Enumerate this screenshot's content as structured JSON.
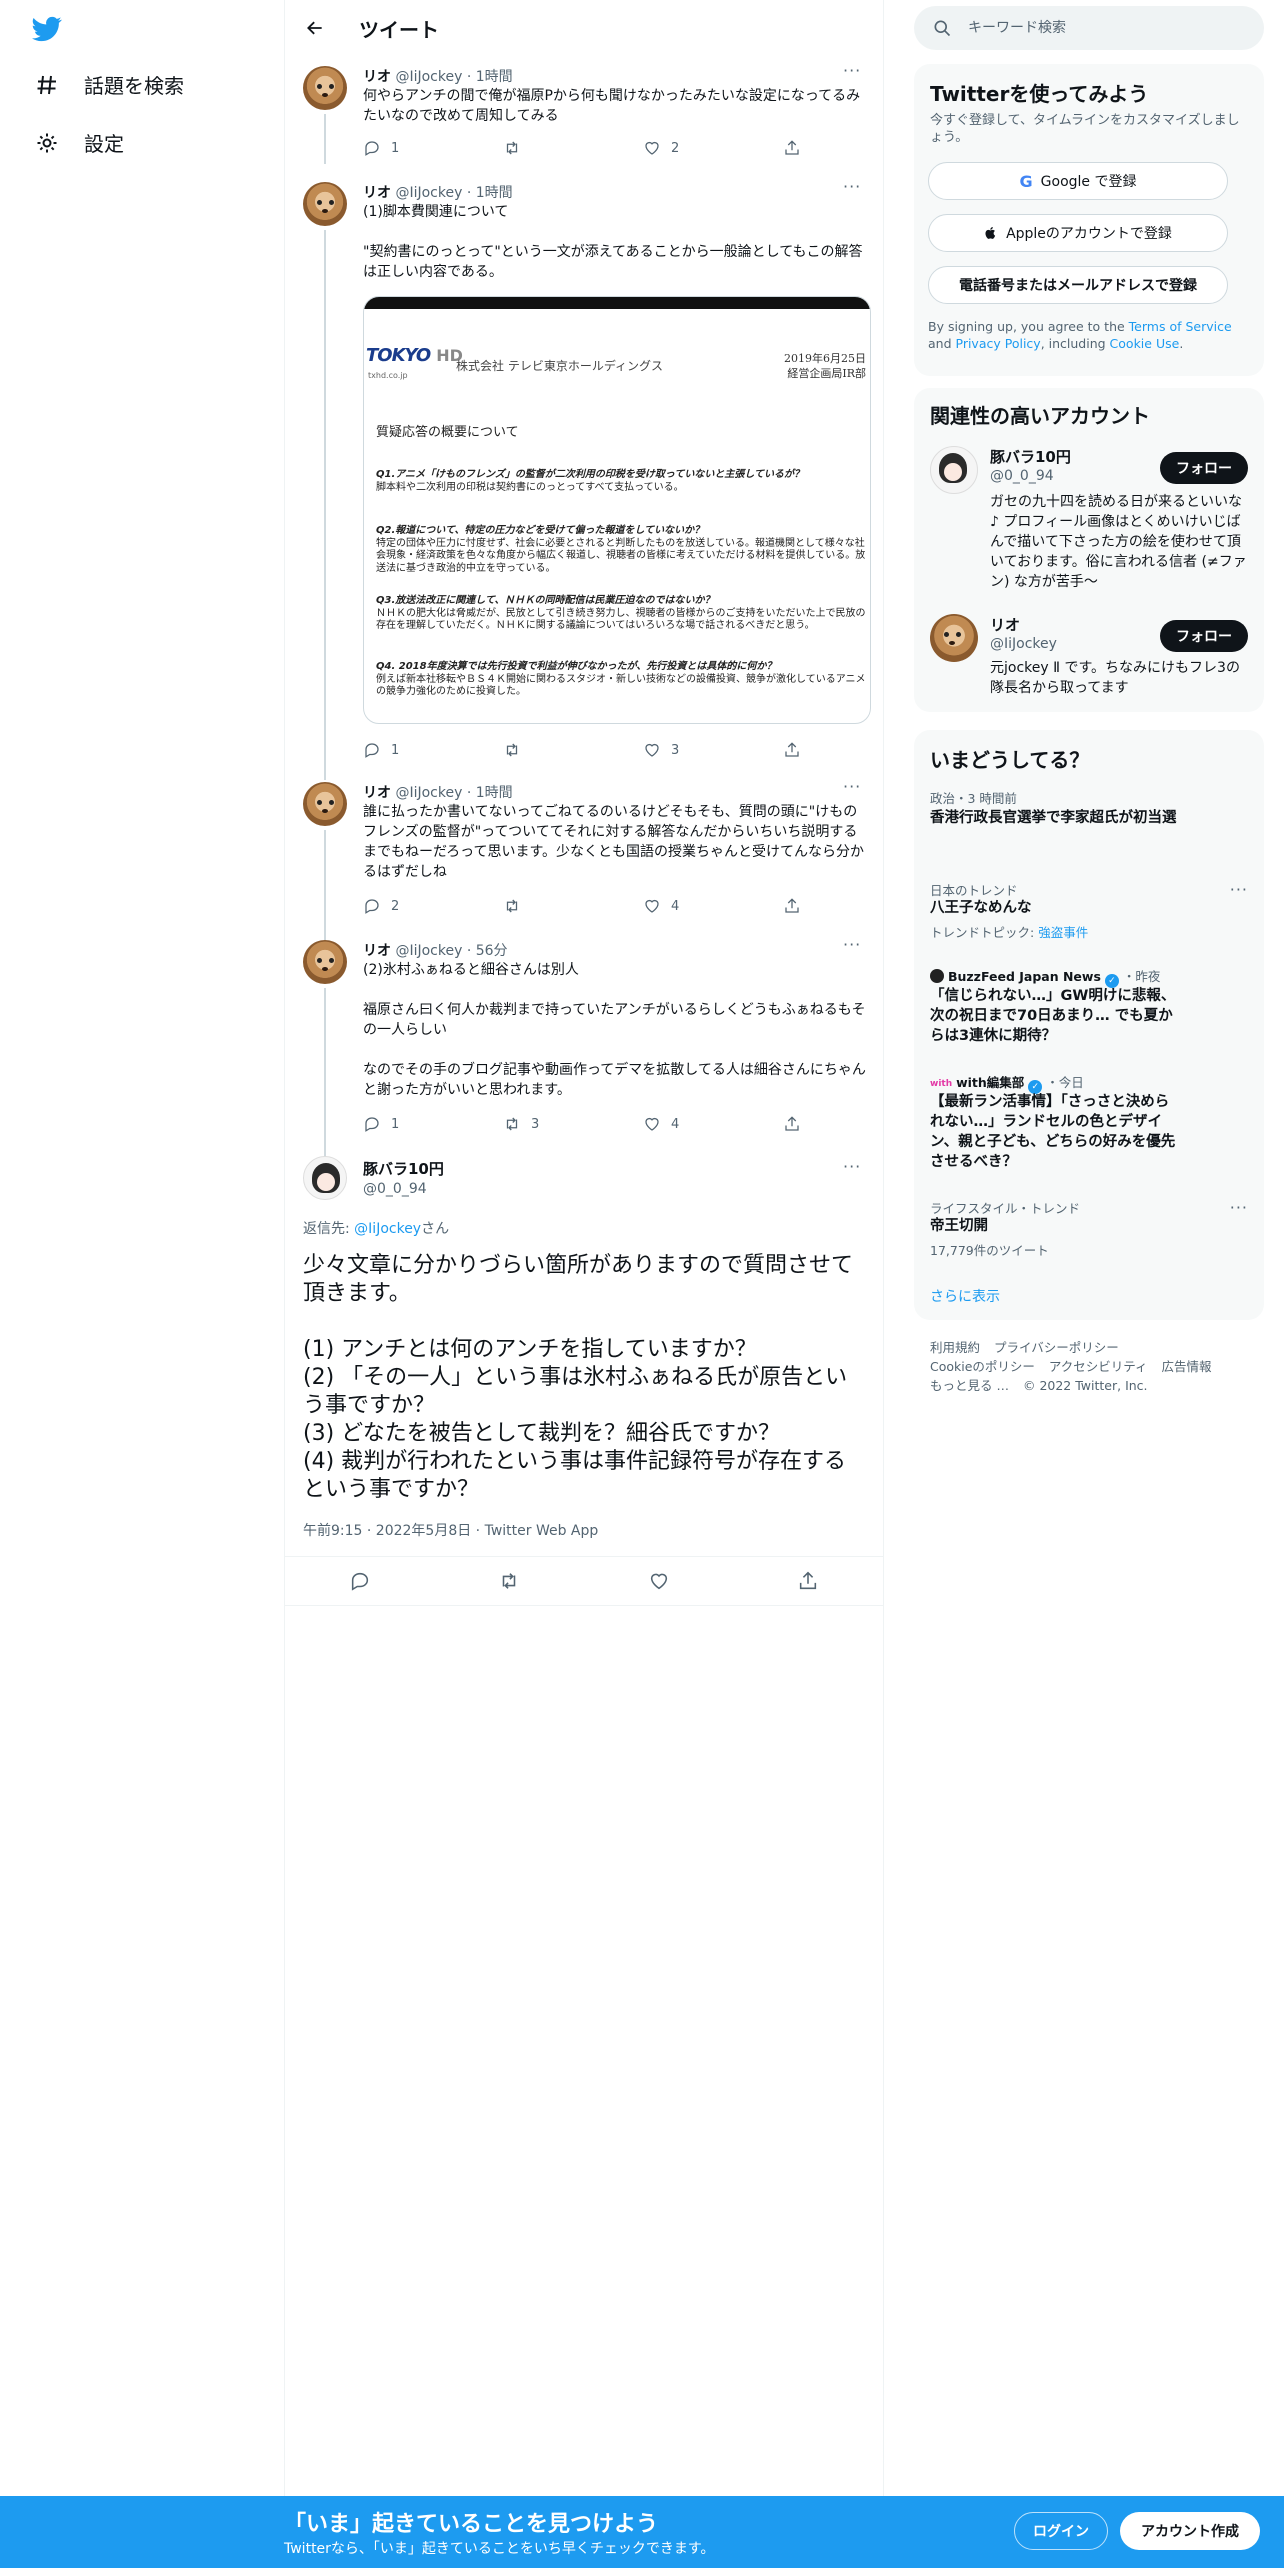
{
  "nav": {
    "explore_label": "話題を検索",
    "settings_label": "設定"
  },
  "header": {
    "title": "ツイート"
  },
  "tweets": [
    {
      "name": "リオ",
      "handle": "@IiJockey",
      "time": "1時間",
      "text": "何やらアンチの間で俺が福原Pから何も聞けなかったみたいな設定になってるみたいなので改めて周知してみる",
      "replies": "1",
      "retweets": "",
      "likes": "2"
    },
    {
      "name": "リオ",
      "handle": "@IiJockey",
      "time": "1時間",
      "text": "(1)脚本費関連について\n\n\"契約書にのっとって\"という一文が添えてあることから一般論としてもこの解答は正しい内容である。",
      "replies": "1",
      "retweets": "",
      "likes": "3",
      "image": {
        "logo_text": "TOKYO",
        "logo_hd": "HD",
        "url": "txhd.co.jp",
        "company": "株式会社 テレビ東京ホールディングス",
        "date": "2019年6月25日",
        "dept": "経営企画局IR部",
        "section": "質疑応答の概要について",
        "qa": [
          {
            "q": "Q1.アニメ「けものフレンズ」の監督が二次利用の印税を受け取っていないと主張しているが？",
            "a": "脚本料や二次利用の印税は契約書にのっとってすべて支払っている。"
          },
          {
            "q": "Q2.報道について、特定の圧力などを受けて偏った報道をしていないか？",
            "a": "特定の団体や圧力に忖度せず、社会に必要とされると判断したものを放送している。報道機関として様々な社会現象・経済政策を色々な角度から幅広く報道し、視聴者の皆様に考えていただける材料を提供している。放送法に基づき政治的中立を守っている。"
          },
          {
            "q": "Q3.放送法改正に関連して、ＮＨＫの同時配信は民業圧迫なのではないか？",
            "a": "ＮＨＫの肥大化は脅威だが、民放として引き続き努力し、視聴者の皆様からのご支持をいただいた上で民放の存在を理解していただく。ＮＨＫに関する議論についてはいろいろな場で話されるべきだと思う。"
          },
          {
            "q": "Q4. 2018年度決算では先行投資で利益が伸びなかったが、先行投資とは具体的に何か？",
            "a": "例えば新本社移転やＢＳ４Ｋ開始に関わるスタジオ・新しい技術などの設備投資、競争が激化しているアニメの競争力強化のために投資した。"
          }
        ]
      }
    },
    {
      "name": "リオ",
      "handle": "@IiJockey",
      "time": "1時間",
      "text": "誰に払ったか書いてないってごねてるのいるけどそもそも、質問の頭に\"けものフレンズの監督が\"ってついててそれに対する解答なんだからいちいち説明するまでもねーだろって思います。少なくとも国語の授業ちゃんと受けてんなら分かるはずだしね",
      "replies": "2",
      "retweets": "",
      "likes": "4"
    },
    {
      "name": "リオ",
      "handle": "@IiJockey",
      "time": "56分",
      "text": "(2)氷村ふぁねると細谷さんは別人\n\n福原さん曰く何人か裁判まで持っていたアンチがいるらしくどうもふぁねるもその一人らしい\n\nなのでその手のブログ記事や動画作ってデマを拡散してる人は細谷さんにちゃんと謝った方がいいと思われます。",
      "replies": "1",
      "retweets": "3",
      "likes": "4"
    }
  ],
  "main_tweet": {
    "name": "豚バラ10円",
    "handle": "@0_0_94",
    "reply_prefix": "返信先: ",
    "reply_to": "@IiJockey",
    "reply_suffix": "さん",
    "text": "少々文章に分かりづらい箇所がありますので質問させて頂きます。\n\n(1) アンチとは何のアンチを指していますか？\n(2) 「その一人」という事は氷村ふぁねる氏が原告という事ですか？\n(3) どなたを被告として裁判を？細谷氏ですか？\n(4) 裁判が行われたという事は事件記録符号が存在するという事ですか？",
    "meta": "午前9:15 · 2022年5月8日 · Twitter Web App"
  },
  "search": {
    "placeholder": "キーワード検索"
  },
  "signup_card": {
    "title": "Twitterを使ってみよう",
    "subtitle": "今すぐ登録して、タイムラインをカスタマイズしましょう。",
    "google": "Google で登録",
    "apple": "Appleのアカウントで登録",
    "phone": "電話番号またはメールアドレスで登録",
    "terms_1": "By signing up, you agree to the ",
    "terms_link": "Terms of Service",
    "terms_2": " and ",
    "privacy_link": "Privacy Policy",
    "terms_3": ", including ",
    "cookie_link": "Cookie Use",
    "terms_4": "."
  },
  "related": {
    "title": "関連性の高いアカウント",
    "accounts": [
      {
        "name": "豚バラ10円",
        "handle": "@0_0_94",
        "bio": "ガセの九十四を読める日が来るといいな♪ プロフィール画像はとくめいけいじばんで描いて下さった方の絵を使わせて頂いております。俗に言われる信者 (≠ファン) な方が苦手～",
        "follow": "フォロー"
      },
      {
        "name": "リオ",
        "handle": "@IiJockey",
        "bio": "元jockey Ⅱ です。ちなみにけもフレ3の隊長名から取ってます",
        "follow": "フォロー"
      }
    ]
  },
  "trends": {
    "title": "いまどうしてる？",
    "items": [
      {
        "context": "政治・3 時間前",
        "title": "香港行政長官選挙で李家超氏が初当選",
        "sub": ""
      },
      {
        "context": "日本のトレンド",
        "title": "八王子なめんな",
        "sub_prefix": "トレンドトピック: ",
        "sub_link": "強盗事件"
      },
      {
        "source": "BuzzFeed Japan News",
        "context": "・昨夜",
        "title": "「信じられない…」GW明けに悲報、次の祝日まで70日あまり… でも夏からは3連休に期待？"
      },
      {
        "source": "with編集部",
        "context": "・今日",
        "title": "【最新ラン活事情】「さっさと決められない…」ランドセルの色とデザイン、親と子ども、どちらの好みを優先させるべき？"
      },
      {
        "context": "ライフスタイル・トレンド",
        "title": "帝王切開",
        "sub": "17,779件のツイート"
      }
    ],
    "show_more": "さらに表示"
  },
  "footer": {
    "terms": "利用規約",
    "privacy": "プライバシーポリシー",
    "cookie": "Cookieのポリシー",
    "accessibility": "アクセシビリティ",
    "ads": "広告情報",
    "more": "もっと見る …",
    "copyright": "© 2022 Twitter, Inc."
  },
  "bottom_bar": {
    "title": "「いま」起きていることを見つけよう",
    "subtitle": "Twitterなら、「いま」起きていることをいち早くチェックできます。",
    "login": "ログイン",
    "signup": "アカウント作成"
  }
}
